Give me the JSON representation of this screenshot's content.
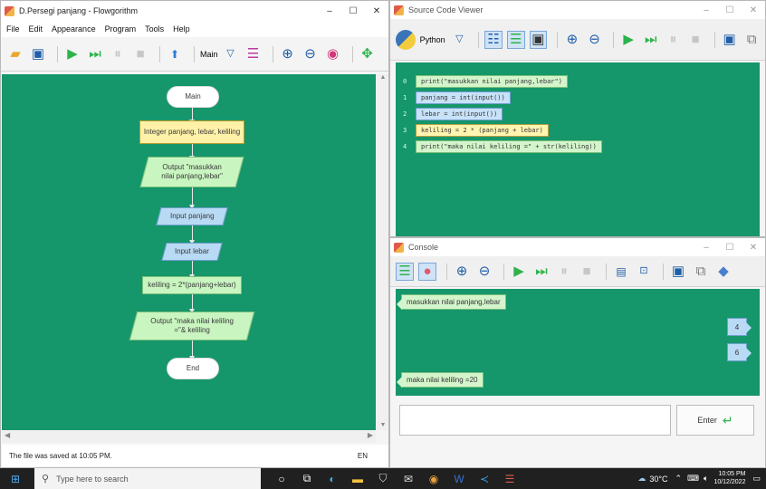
{
  "flowgorithm": {
    "title": "D.Persegi panjang - Flowgorithm",
    "menu": [
      "File",
      "Edit",
      "Appearance",
      "Program",
      "Tools",
      "Help"
    ],
    "function_select": "Main",
    "flow": {
      "start": "Main",
      "declare": "Integer panjang, lebar, keliling",
      "output1": "Output \"masukkan nilai panjang,lebar\"",
      "input1": "Input panjang",
      "input2": "Input lebar",
      "assign": "keliling = 2*(panjang+lebar)",
      "output2": "Output \"maka nilai keliling =\"& keliling",
      "end": "End"
    },
    "status": "The file was saved at 10:05 PM.",
    "lang_indicator": "EN"
  },
  "source": {
    "title": "Source Code Viewer",
    "language": "Python",
    "lines": [
      {
        "num": "0",
        "code": "print(\"masukkan nilai panjang,lebar\")"
      },
      {
        "num": "1",
        "code": "panjang = int(input())"
      },
      {
        "num": "2",
        "code": "lebar = int(input())"
      },
      {
        "num": "3",
        "code": "keliling = 2 * (panjang + lebar)"
      },
      {
        "num": "4",
        "code": "print(\"maka nilai keliling =\" + str(keliling))"
      }
    ]
  },
  "console": {
    "title": "Console",
    "out1": "masukkan nilai panjang,lebar",
    "in1": "4",
    "in2": "6",
    "out2": "maka nilai keliling =20",
    "enter_label": "Enter"
  },
  "taskbar": {
    "search_placeholder": "Type here to search",
    "weather": "30°C",
    "time": "10:05 PM",
    "date": "10/12/2022"
  },
  "colors": {
    "canvas": "#16966b",
    "accent": "#1f5ea8",
    "play": "#2db34a"
  }
}
